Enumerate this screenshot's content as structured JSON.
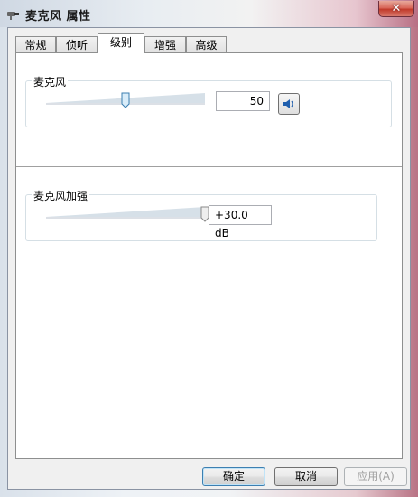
{
  "window": {
    "title": "麦克风 属性",
    "close_label": "✕"
  },
  "tabs": [
    {
      "label": "常规",
      "active": false
    },
    {
      "label": "侦听",
      "active": false
    },
    {
      "label": "级别",
      "active": true
    },
    {
      "label": "增强",
      "active": false
    },
    {
      "label": "高级",
      "active": false
    }
  ],
  "microphone": {
    "label": "麦克风",
    "level": 50,
    "value_text": "50"
  },
  "boost": {
    "label": "麦克风加强",
    "level": 1.0,
    "value_text": "+30.0 dB"
  },
  "buttons": {
    "ok": "确定",
    "cancel": "取消",
    "apply": "应用(A)"
  },
  "icons": {
    "speaker": "speaker-icon",
    "window": "microphone-window-icon"
  }
}
